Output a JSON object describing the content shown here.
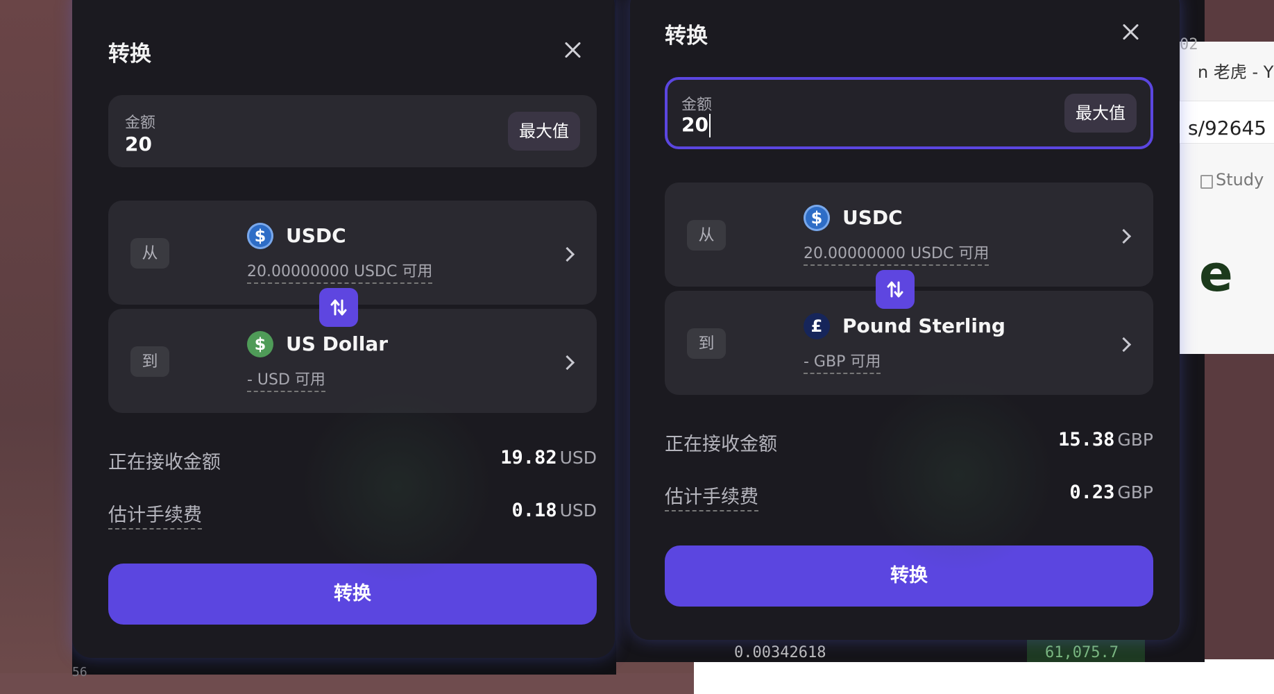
{
  "background": {
    "left_terminal_bottom_number": "56",
    "right_terminal_price": "0.00342618",
    "right_terminal_value": "61,075.7",
    "browser_date_fragment": "02",
    "browser_tab_text": "n 老虎 - Y",
    "browser_url_text": "s/92645",
    "browser_bookmark": "Study",
    "browser_headline_fragment": "e"
  },
  "left_modal": {
    "title": "转换",
    "amount": {
      "label": "金额",
      "value": "20",
      "max_label": "最大值"
    },
    "from": {
      "direction": "从",
      "asset": "USDC",
      "coin_symbol": "$",
      "available": "20.00000000 USDC 可用"
    },
    "to": {
      "direction": "到",
      "asset": "US Dollar",
      "coin_symbol": "$",
      "available": "- USD 可用"
    },
    "receiving": {
      "label": "正在接收金额",
      "value": "19.82",
      "unit": "USD"
    },
    "fee": {
      "label": "估计手续费",
      "value": "0.18",
      "unit": "USD"
    },
    "submit_label": "转换"
  },
  "right_modal": {
    "title": "转换",
    "amount": {
      "label": "金额",
      "value": "20",
      "max_label": "最大值"
    },
    "from": {
      "direction": "从",
      "asset": "USDC",
      "coin_symbol": "$",
      "available": "20.00000000 USDC 可用"
    },
    "to": {
      "direction": "到",
      "asset": "Pound Sterling",
      "coin_symbol": "£",
      "available": "- GBP 可用"
    },
    "receiving": {
      "label": "正在接收金额",
      "value": "15.38",
      "unit": "GBP"
    },
    "fee": {
      "label": "估计手续费",
      "value": "0.23",
      "unit": "GBP"
    },
    "submit_label": "转换"
  },
  "colors": {
    "accent": "#5b46e0",
    "modal_bg": "#1b1a20",
    "card_bg": "#2a2930"
  },
  "icons": [
    "close-icon",
    "usdc-coin-icon",
    "usd-coin-icon",
    "gbp-coin-icon",
    "swap-arrows-icon",
    "chevron-right-icon"
  ]
}
